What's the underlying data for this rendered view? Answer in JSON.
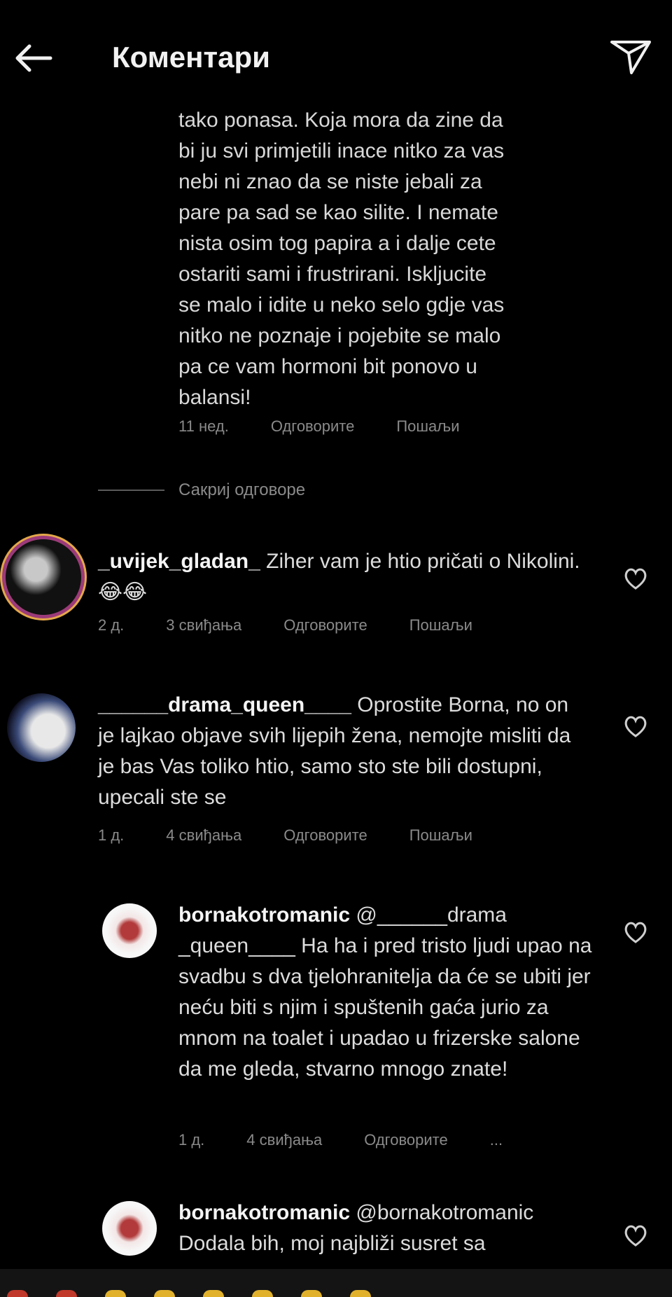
{
  "header": {
    "title": "Коментари"
  },
  "first_comment": {
    "lines": [
      "tako ponasa. Koja mora da zine da",
      "bi ju svi primjetili inace nitko za vas",
      "nebi ni znao da se niste jebali za",
      "pare pa sad se kao silite. I nemate",
      "nista osim tog papira a i dalje cete",
      "ostariti sami i frustrirani. Iskljucite",
      "se malo i idite u neko selo gdje vas",
      "nitko ne poznaje i pojebite se malo",
      "pa ce vam hormoni bit ponovo u",
      "balansi!"
    ],
    "time": "11 нед.",
    "reply": "Одговорите",
    "send": "Пошаљи"
  },
  "view_replies": "Сакриј одговоре",
  "comments": [
    {
      "username": "_uvijek_gladan_",
      "text": "Ziher vam je htio pričati o Nikolini. 😂😂",
      "time": "2 д.",
      "likes": "3 свиђања",
      "reply": "Одговорите",
      "send": "Пошаљи"
    },
    {
      "username": "______drama_queen____",
      "text": "Oprostite Borna, no on je lajkao objave svih lijepih žena, nemojte misliti da je bas Vas toliko htio, samo sto ste bili dostupni, upecali ste se",
      "time": "1 д.",
      "likes": "4 свиђања",
      "reply": "Одговорите",
      "send": "Пошаљи"
    },
    {
      "username": "bornakotromanic",
      "text": "@______drama _queen____ Ha ha i pred tristo ljudi upao na svadbu s dva tjelohranitelja da će se ubiti jer neću biti s njim i spuštenih gaća jurio za mnom na toalet i upadao u frizerske salone da me gleda, stvarno mnogo znate!",
      "time": "1 д.",
      "likes": "4 свиђања",
      "reply": "Одговорите",
      "send": "..."
    },
    {
      "username": "bornakotromanic",
      "text": "@bornakotromanic Dodala bih, moj najbliži susret sa",
      "time": "",
      "likes": "",
      "reply": "",
      "send": ""
    }
  ],
  "colors": {
    "background": "#000000",
    "text": "#dcdcdc",
    "meta": "#8a8a8a"
  }
}
